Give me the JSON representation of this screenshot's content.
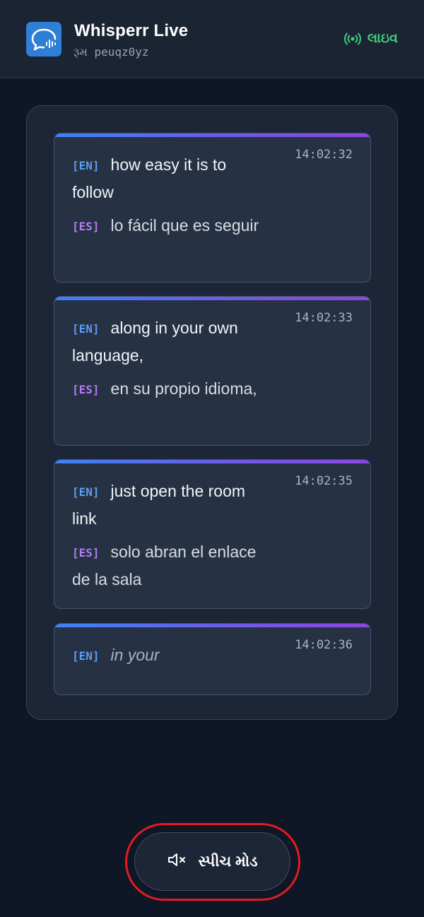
{
  "header": {
    "app_title": "Whisperr Live",
    "room_line": "રૂમ peuqz0yz",
    "live_label": "લાઇવ",
    "logo_icon": "chat-bubble-waveform-icon",
    "live_icon": "broadcast-icon"
  },
  "feed": {
    "cards": [
      {
        "time": "14:02:32",
        "en_tag": "[EN]",
        "en_text": "how easy it is to follow",
        "es_tag": "[ES]",
        "es_text": "lo fácil que es seguir"
      },
      {
        "time": "14:02:33",
        "en_tag": "[EN]",
        "en_text": "along in your own language,",
        "es_tag": "[ES]",
        "es_text": "en su propio idioma,"
      },
      {
        "time": "14:02:35",
        "en_tag": "[EN]",
        "en_text": "just open the room link",
        "es_tag": "[ES]",
        "es_text": "solo abran el enlace de la sala"
      },
      {
        "time": "14:02:36",
        "en_tag": "[EN]",
        "en_text": "in your"
      }
    ]
  },
  "speech_button": {
    "label": "સ્પીચ મોડ",
    "icon": "speaker-muted-icon"
  },
  "colors": {
    "background": "#0f1626",
    "header": "#1b2433",
    "card": "#263244",
    "live": "#3ecf7c",
    "en_tag": "#5b9cf0",
    "es_tag": "#b57af0",
    "accent_start": "#3b82f6",
    "accent_end": "#8b46e0",
    "highlight_ring": "#e31b23"
  }
}
